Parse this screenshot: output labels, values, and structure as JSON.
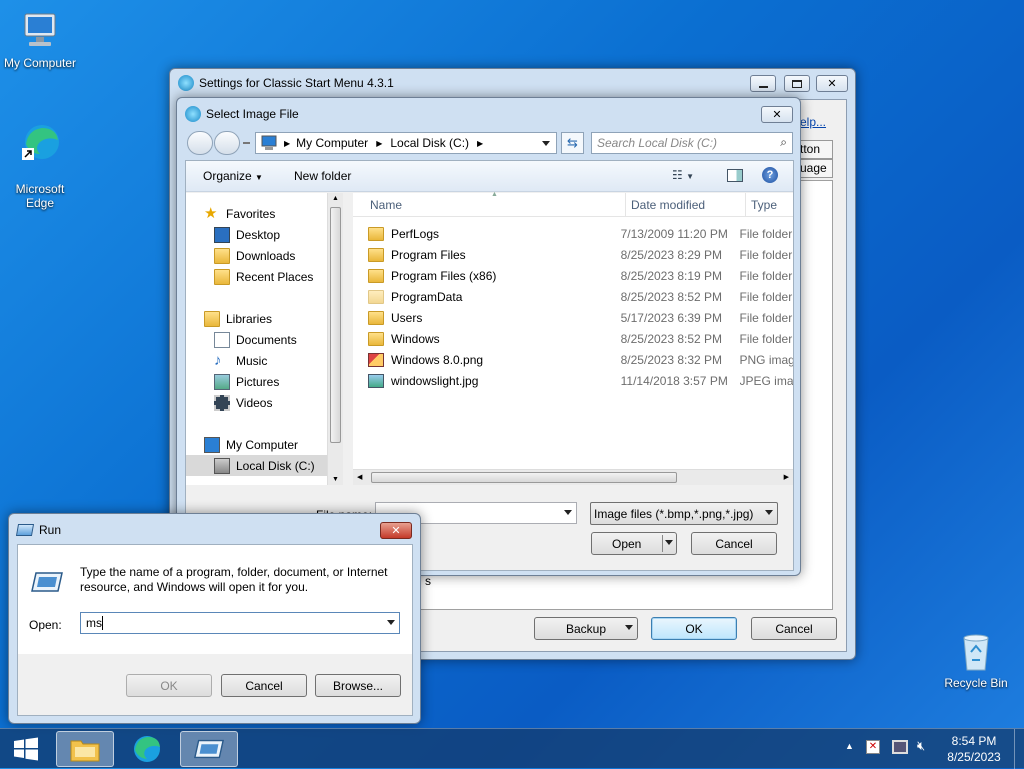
{
  "desktop": {
    "icons": [
      {
        "label": "My Computer",
        "icon": "computer-icon"
      },
      {
        "label": "Microsoft\nEdge",
        "icon": "edge-icon"
      },
      {
        "label": "Recycle Bin",
        "icon": "recycle-bin-icon"
      }
    ]
  },
  "settings_window": {
    "title": "Settings for Classic Start Menu 4.3.1",
    "partial_link": "elp...",
    "partial_tab1": "tton",
    "partial_tab2": "uage",
    "partial_text": "s",
    "backup_label": "Backup",
    "ok_label": "OK",
    "cancel_label": "Cancel"
  },
  "file_dialog": {
    "title": "Select Image File",
    "breadcrumb": [
      "My Computer",
      "Local Disk (C:)"
    ],
    "search_placeholder": "Search Local Disk (C:)",
    "organize_label": "Organize",
    "new_folder_label": "New folder",
    "nav": {
      "favorites": {
        "label": "Favorites",
        "items": [
          "Desktop",
          "Downloads",
          "Recent Places"
        ]
      },
      "libraries": {
        "label": "Libraries",
        "items": [
          "Documents",
          "Music",
          "Pictures",
          "Videos"
        ]
      },
      "computer": {
        "label": "My Computer",
        "items": [
          "Local Disk (C:)"
        ]
      }
    },
    "columns": [
      "Name",
      "Date modified",
      "Type"
    ],
    "files": [
      {
        "name": "PerfLogs",
        "date": "7/13/2009 11:20 PM",
        "type": "File folder",
        "icon": "folder-icon"
      },
      {
        "name": "Program Files",
        "date": "8/25/2023 8:29 PM",
        "type": "File folder",
        "icon": "folder-icon"
      },
      {
        "name": "Program Files (x86)",
        "date": "8/25/2023 8:19 PM",
        "type": "File folder",
        "icon": "folder-icon"
      },
      {
        "name": "ProgramData",
        "date": "8/25/2023 8:52 PM",
        "type": "File folder",
        "icon": "folder-icon"
      },
      {
        "name": "Users",
        "date": "5/17/2023 6:39 PM",
        "type": "File folder",
        "icon": "folder-icon"
      },
      {
        "name": "Windows",
        "date": "8/25/2023 8:52 PM",
        "type": "File folder",
        "icon": "folder-icon"
      },
      {
        "name": "Windows 8.0.png",
        "date": "8/25/2023 8:32 PM",
        "type": "PNG image",
        "icon": "png-file-icon"
      },
      {
        "name": "windowslight.jpg",
        "date": "11/14/2018 3:57 PM",
        "type": "JPEG image",
        "icon": "jpg-file-icon"
      }
    ],
    "filename_label": "File name:",
    "filename_value": "",
    "filetype_value": "Image files (*.bmp,*.png,*.jpg)",
    "open_label": "Open",
    "cancel_label": "Cancel"
  },
  "run_dialog": {
    "title": "Run",
    "description": "Type the name of a program, folder, document, or Internet resource, and Windows will open it for you.",
    "open_label": "Open:",
    "open_value": "ms",
    "ok_label": "OK",
    "cancel_label": "Cancel",
    "browse_label": "Browse..."
  },
  "taskbar": {
    "time": "8:54 PM",
    "date": "8/25/2023"
  }
}
